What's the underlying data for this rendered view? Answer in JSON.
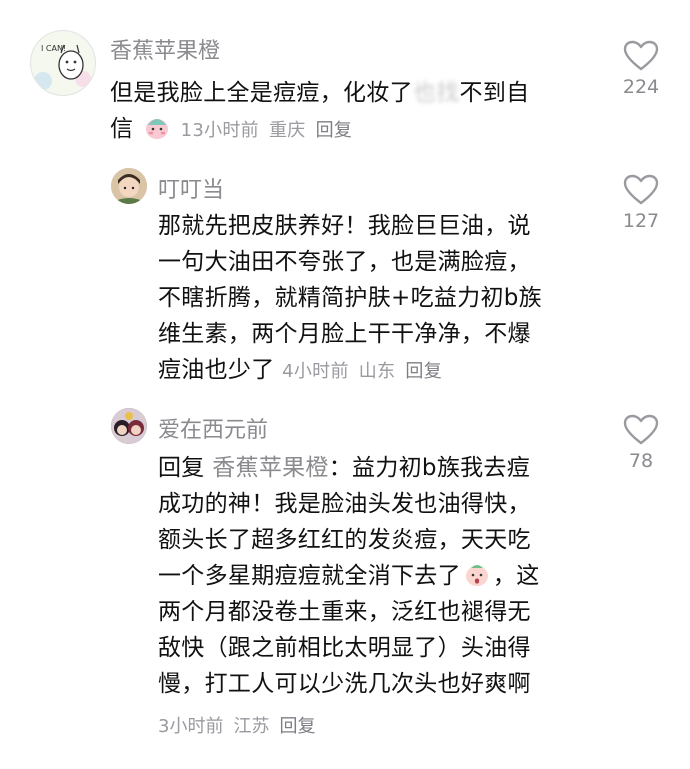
{
  "comments": [
    {
      "username": "香蕉苹果橙",
      "text_line1_a": "但是我脸上全是痘痘，化妆了",
      "text_line1_blur": "也找",
      "text_line1_b": "不到自",
      "text_line2": "信",
      "time": "13小时前",
      "location": "重庆",
      "reply_label": "回复",
      "likes": "224",
      "avatar_text": "I CAN!"
    },
    {
      "username": "叮叮当",
      "text_lines": [
        "那就先把皮肤养好！我脸巨巨油，说",
        "一句大油田不夸张了，也是满脸痘，",
        "不瞎折腾，就精简护肤+吃益力初b族",
        "维生素，两个月脸上干干净净，不爆",
        "痘油也少了"
      ],
      "time": "4小时前",
      "location": "山东",
      "reply_label": "回复",
      "likes": "127"
    },
    {
      "username": "爱在西元前",
      "reply_prefix": "回复",
      "reply_target": "香蕉苹果橙",
      "line1_rest": "：益力初b族我去痘",
      "text_lines": [
        "成功的神！我是脸油头发也油得快，",
        "额头长了超多红红的发炎痘，天天吃"
      ],
      "line4_a": "一个多星期痘痘就全消下去了",
      "line4_b": "，这",
      "text_lines2": [
        "两个月都没卷土重来，泛红也褪得无",
        "敌快（跟之前相比太明显了）头油得",
        "慢，打工人可以少洗几次头也好爽啊"
      ],
      "time": "3小时前",
      "location": "江苏",
      "reply_label": "回复",
      "likes": "78"
    }
  ],
  "colors": {
    "text": "#111111",
    "muted": "#8a8a8f",
    "heart": "#9a9aa0"
  }
}
